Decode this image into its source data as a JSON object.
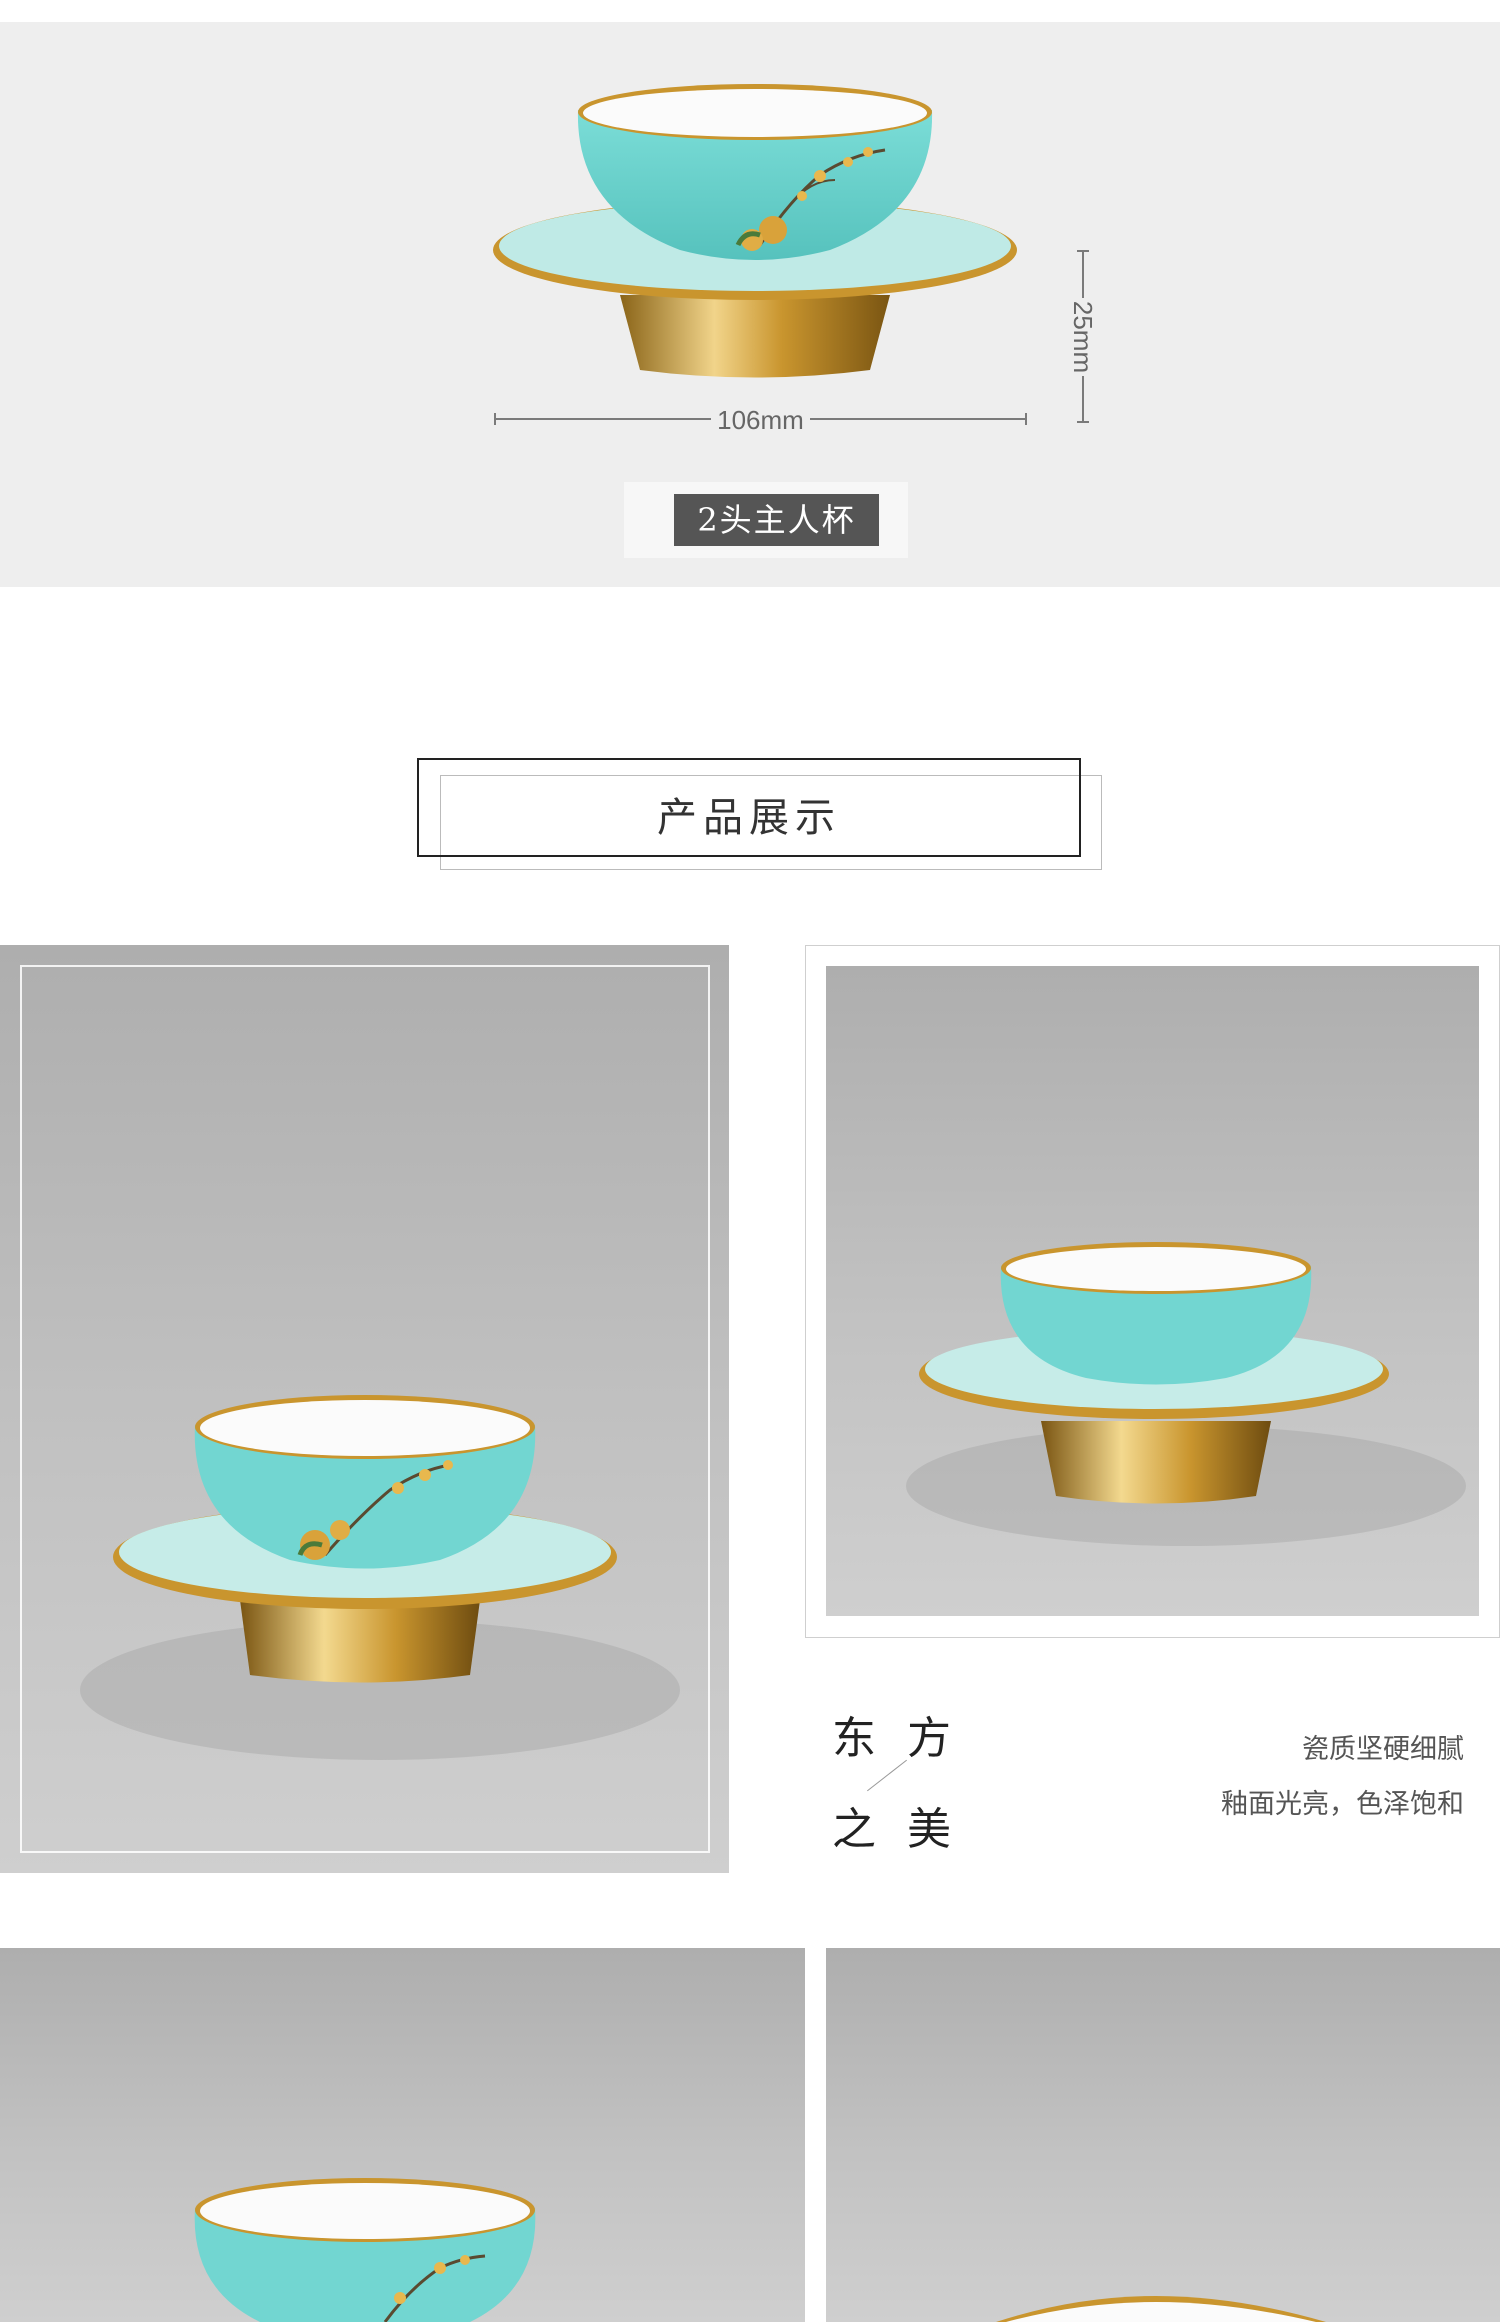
{
  "dimensions": {
    "width_label": "106mm",
    "height_label": "25mm"
  },
  "caption": "2头主人杯",
  "section_heading": "产品展示",
  "feature_text": {
    "poem_chars": [
      "东",
      "方",
      "之",
      "美"
    ],
    "desc_line1": "瓷质坚硬细腻",
    "desc_line2": "釉面光亮，色泽饱和"
  },
  "colors": {
    "turquoise": "#6fd3cf",
    "gold": "#c99a3a",
    "panel_gray": "#eeeeee",
    "caption_bg": "#555555"
  }
}
